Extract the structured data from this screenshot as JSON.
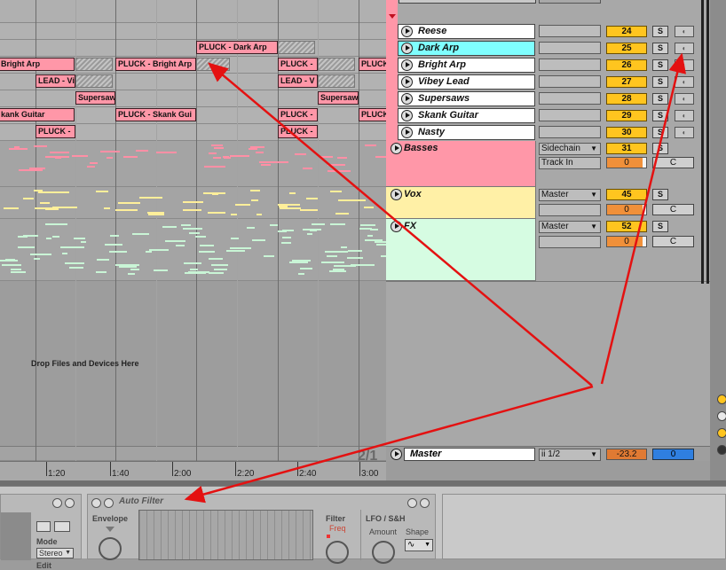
{
  "arrangement": {
    "drop_hint": "Drop Files and Devices Here",
    "clips": [
      {
        "name": "PLUCK - Dark Arp"
      },
      {
        "name": "Bright Arp"
      },
      {
        "name": "PLUCK - Bright Arp"
      },
      {
        "name": "PLUCK -"
      },
      {
        "name": "PLUCK"
      },
      {
        "name": "LEAD - Vi"
      },
      {
        "name": "LEAD - V"
      },
      {
        "name": "Supersaw"
      },
      {
        "name": "Supersaw"
      },
      {
        "name": "kank Guitar"
      },
      {
        "name": "PLUCK - Skank Gui"
      },
      {
        "name": "PLUCK -"
      },
      {
        "name": "PLUCK"
      },
      {
        "name": "PLUCK -"
      },
      {
        "name": "PLUCK -"
      }
    ],
    "ruler_labels": [
      "1:20",
      "1:40",
      "2:00",
      "2:20",
      "2:40",
      "3:00"
    ],
    "loop_number": "2/1"
  },
  "tracks": [
    {
      "name": "Reese",
      "number": "24",
      "solo": "S"
    },
    {
      "name": "Dark Arp",
      "number": "25",
      "solo": "S"
    },
    {
      "name": "Bright Arp",
      "number": "26",
      "solo": "S"
    },
    {
      "name": "Vibey Lead",
      "number": "27",
      "solo": "S"
    },
    {
      "name": "Supersaws",
      "number": "28",
      "solo": "S"
    },
    {
      "name": "Skank Guitar",
      "number": "29",
      "solo": "S"
    },
    {
      "name": "Nasty",
      "number": "30",
      "solo": "S"
    }
  ],
  "groups": [
    {
      "name": "Basses",
      "route": "Sidechain",
      "route2": "Track In",
      "number": "31",
      "solo": "S",
      "vol": "0",
      "pan": "C"
    },
    {
      "name": "Vox",
      "route": "Master",
      "number": "45",
      "solo": "S",
      "vol": "0",
      "pan": "C"
    },
    {
      "name": "FX",
      "route": "Master",
      "number": "52",
      "solo": "S",
      "vol": "0",
      "pan": "C"
    }
  ],
  "master": {
    "name": "Master",
    "route": "ii 1/2",
    "vol": "-23.2",
    "send": "0"
  },
  "device": {
    "title": "Auto Filter",
    "envelope": "Envelope",
    "filter": "Filter",
    "freq": "Freq",
    "lfo": "LFO / S&H",
    "amount": "Amount",
    "shape": "Shape",
    "mode_label": "Mode",
    "mode_value": "Stereo",
    "edit": "Edit"
  },
  "colors": {
    "clip": "#ff97a8",
    "accent_cyan": "#7fffff",
    "yellow": "#ffc51f",
    "arrow": "#e41111",
    "basses": "#ff97a8",
    "vox": "#fff0a6",
    "fx": "#d6fce2"
  }
}
